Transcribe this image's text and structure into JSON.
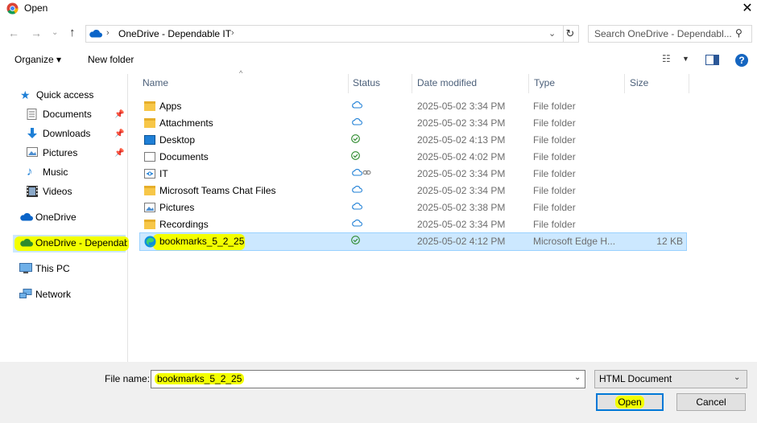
{
  "window": {
    "title": "Open",
    "close_glyph": "✕"
  },
  "address": {
    "path": "OneDrive - Dependable IT"
  },
  "search": {
    "placeholder": "Search OneDrive - Dependabl..."
  },
  "toolbar": {
    "organize_label": "Organize ▾",
    "new_folder_label": "New folder"
  },
  "sidebar": {
    "quick_access": "Quick access",
    "items": [
      {
        "label": "Documents",
        "icon": "documents-icon",
        "pinned": true
      },
      {
        "label": "Downloads",
        "icon": "downloads-icon",
        "pinned": true
      },
      {
        "label": "Pictures",
        "icon": "pictures-icon",
        "pinned": true
      },
      {
        "label": "Music",
        "icon": "music-icon",
        "pinned": false
      },
      {
        "label": "Videos",
        "icon": "videos-icon",
        "pinned": false
      }
    ],
    "onedrive": "OneDrive",
    "onedrive_business": "OneDrive - Dependab",
    "this_pc": "This PC",
    "network": "Network"
  },
  "columns": {
    "name": "Name",
    "status": "Status",
    "date": "Date modified",
    "type": "Type",
    "size": "Size"
  },
  "files": [
    {
      "name": "Apps",
      "status": "cloud",
      "date": "2025-05-02 3:34 PM",
      "type": "File folder",
      "size": ""
    },
    {
      "name": "Attachments",
      "status": "cloud",
      "date": "2025-05-02 3:34 PM",
      "type": "File folder",
      "size": ""
    },
    {
      "name": "Desktop",
      "status": "synced",
      "date": "2025-05-02 4:13 PM",
      "type": "File folder",
      "size": ""
    },
    {
      "name": "Documents",
      "status": "synced",
      "date": "2025-05-02 4:02 PM",
      "type": "File folder",
      "size": ""
    },
    {
      "name": "IT",
      "status": "cloud-shared",
      "date": "2025-05-02 3:34 PM",
      "type": "File folder",
      "size": ""
    },
    {
      "name": "Microsoft Teams Chat Files",
      "status": "cloud",
      "date": "2025-05-02 3:34 PM",
      "type": "File folder",
      "size": ""
    },
    {
      "name": "Pictures",
      "status": "cloud",
      "date": "2025-05-02 3:38 PM",
      "type": "File folder",
      "size": ""
    },
    {
      "name": "Recordings",
      "status": "cloud",
      "date": "2025-05-02 3:34 PM",
      "type": "File folder",
      "size": ""
    },
    {
      "name": "bookmarks_5_2_25",
      "status": "synced",
      "date": "2025-05-02 4:12 PM",
      "type": "Microsoft Edge H...",
      "size": "12 KB"
    }
  ],
  "bottom": {
    "file_name_label": "File name:",
    "file_name_value": "bookmarks_5_2_25",
    "file_type_value": "HTML Document",
    "open_label": "Open",
    "cancel_label": "Cancel"
  },
  "colors": {
    "selection": "#cce8ff",
    "highlight": "#f3ff00",
    "accent": "#0078d7",
    "folder": "#f7c748"
  }
}
